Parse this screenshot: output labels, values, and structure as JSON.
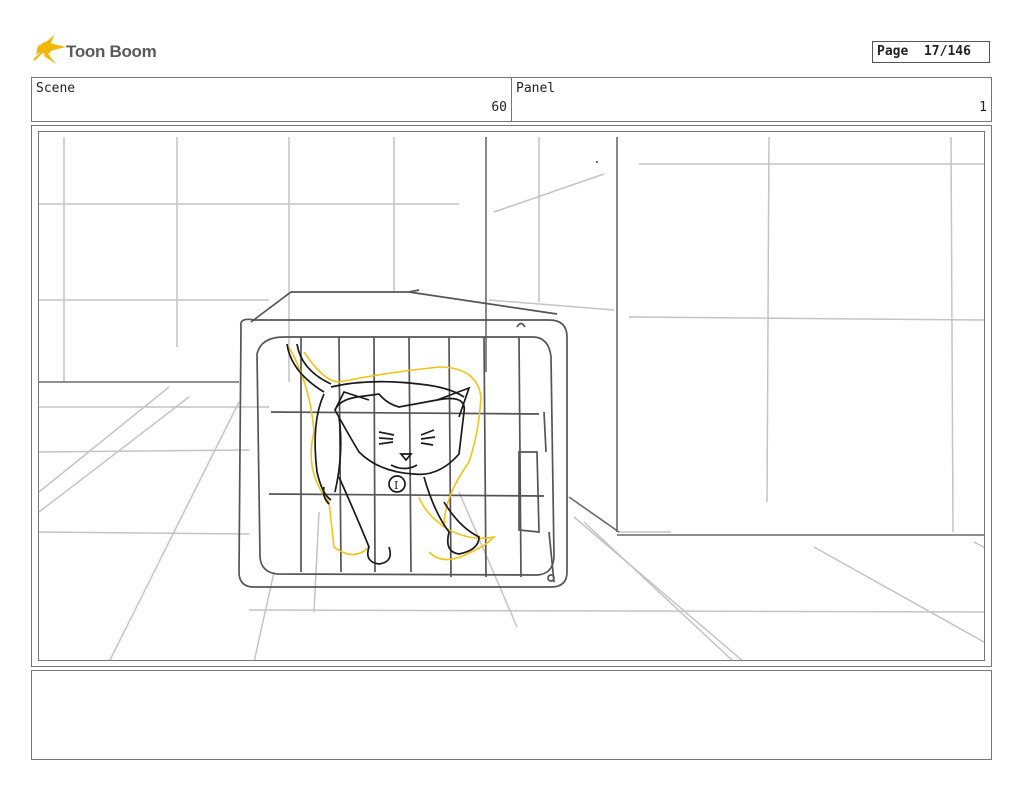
{
  "header": {
    "logo_text": "Toon Boom",
    "page_label": "Page",
    "page_number": "17/146"
  },
  "scene": {
    "label": "Scene",
    "value": "60"
  },
  "panel": {
    "label": "Panel",
    "value": "1"
  },
  "drawing": {
    "tag_letter": "I"
  },
  "notes": {
    "text": ""
  }
}
